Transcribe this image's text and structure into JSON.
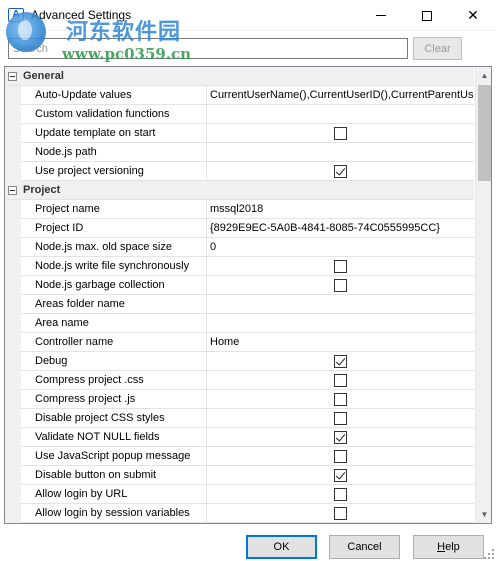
{
  "window": {
    "title": "Advanced Settings",
    "icon_label": "A",
    "minimize_icon": "minimize-icon",
    "maximize_icon": "maximize-icon",
    "close_glyph": "✕"
  },
  "watermark": {
    "brand_cn": "河东软件园",
    "url": "www.pc0359.cn"
  },
  "search": {
    "placeholder": "Search",
    "value": ""
  },
  "clear_label": "Clear",
  "categories": [
    {
      "label": "General",
      "rows": [
        {
          "name": "Auto-Update values",
          "value": "CurrentUserName(),CurrentUserID(),CurrentParentUserID()"
        },
        {
          "name": "Custom validation functions",
          "value": ""
        },
        {
          "name": "Update template on start",
          "checkbox": true,
          "checked": false
        },
        {
          "name": "Node.js path",
          "value": ""
        },
        {
          "name": "Use project versioning",
          "checkbox": true,
          "checked": true
        }
      ]
    },
    {
      "label": "Project",
      "rows": [
        {
          "name": "Project name",
          "value": "mssql2018"
        },
        {
          "name": "Project ID",
          "value": "{8929E9EC-5A0B-4841-8085-74C0555995CC}"
        },
        {
          "name": "Node.js max. old space size",
          "value": "0"
        },
        {
          "name": "Node.js write file synchronously",
          "checkbox": true,
          "checked": false
        },
        {
          "name": "Node.js garbage collection",
          "checkbox": true,
          "checked": false
        },
        {
          "name": "Areas folder name",
          "value": ""
        },
        {
          "name": "Area name",
          "value": ""
        },
        {
          "name": "Controller name",
          "value": "Home"
        },
        {
          "name": "Debug",
          "checkbox": true,
          "checked": true
        },
        {
          "name": "Compress project .css",
          "checkbox": true,
          "checked": false
        },
        {
          "name": "Compress project .js",
          "checkbox": true,
          "checked": false
        },
        {
          "name": "Disable project CSS styles",
          "checkbox": true,
          "checked": false
        },
        {
          "name": "Validate NOT NULL fields",
          "checkbox": true,
          "checked": true
        },
        {
          "name": "Use JavaScript popup message",
          "checkbox": true,
          "checked": false
        },
        {
          "name": "Disable button on submit",
          "checkbox": true,
          "checked": true
        },
        {
          "name": "Allow login by URL",
          "checkbox": true,
          "checked": false
        },
        {
          "name": "Allow login by session variables",
          "checkbox": true,
          "checked": false
        }
      ]
    }
  ],
  "scrollbar": {
    "up_glyph": "▲",
    "down_glyph": "▼"
  },
  "buttons": {
    "ok": "OK",
    "cancel": "Cancel",
    "help_underlined": "H",
    "help_rest": "elp"
  }
}
